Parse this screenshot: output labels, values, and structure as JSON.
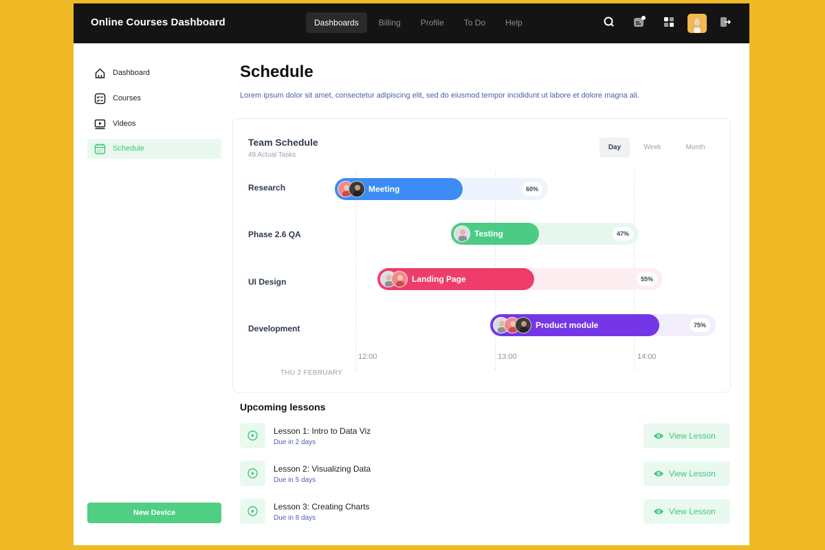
{
  "header": {
    "title": "Online Courses Dashboard",
    "nav": [
      {
        "label": "Dashboards",
        "active": true
      },
      {
        "label": "Billing",
        "active": false
      },
      {
        "label": "Profile",
        "active": false
      },
      {
        "label": "To Do",
        "active": false
      },
      {
        "label": "Help",
        "active": false
      }
    ],
    "icons": [
      "search-icon",
      "notification-icon",
      "apps-grid-icon",
      "avatar",
      "logout-icon"
    ]
  },
  "sidebar": {
    "items": [
      {
        "label": "Dashboard",
        "icon": "home-icon",
        "active": false
      },
      {
        "label": "Courses",
        "icon": "checklist-icon",
        "active": false
      },
      {
        "label": "Videos",
        "icon": "video-icon",
        "active": false
      },
      {
        "label": "Schedule",
        "icon": "calendar-icon",
        "active": true
      }
    ],
    "new_device_label": "New Device"
  },
  "main": {
    "title": "Schedule",
    "subtitle": "Lorem ipsum dolor sit amet, consectetur adipiscing elit, sed do eiusmod  tempor incididunt ut labore et dolore magna ali."
  },
  "schedule": {
    "title": "Team Schedule",
    "subtitle": "49 Actual Tasks",
    "ranges": [
      {
        "label": "Day",
        "active": true
      },
      {
        "label": "Week",
        "active": false
      },
      {
        "label": "Month",
        "active": false
      }
    ],
    "rows": [
      {
        "label": "Research",
        "task": "Meeting",
        "percent": 60,
        "percent_label": "60%",
        "color": "#3b8cf5",
        "track_color": "#eef4fd",
        "avatars": 2
      },
      {
        "label": "Phase 2.6 QA",
        "task": "Testing",
        "percent": 47,
        "percent_label": "47%",
        "color": "#4ccb85",
        "track_color": "#e6f8ee",
        "avatars": 1
      },
      {
        "label": "UI Design",
        "task": "Landing Page",
        "percent": 55,
        "percent_label": "55%",
        "color": "#ee3d6b",
        "track_color": "#fdeef2",
        "avatars": 2
      },
      {
        "label": "Development",
        "task": "Product module",
        "percent": 75,
        "percent_label": "75%",
        "color": "#7436e6",
        "track_color": "#f2eefb",
        "avatars": 3
      }
    ],
    "ticks": [
      "12:00",
      "13:00",
      "14:00"
    ],
    "date_label": "THU 2 FEBRUARY"
  },
  "lessons": {
    "title": "Upcoming lessons",
    "items": [
      {
        "title": "Lesson 1: Intro to Data Viz",
        "due": "Due in 2 days",
        "button": "View Lesson"
      },
      {
        "title": "Lesson 2: Visualizing Data",
        "due": "Due in 5 days",
        "button": "View Lesson"
      },
      {
        "title": "Lesson 3: Creating Charts",
        "due": "Due in 8 days",
        "button": "View Lesson"
      }
    ]
  },
  "colors": {
    "background": "#f0b926",
    "topbar": "#141414",
    "accent_green": "#4fcf84",
    "link_blue": "#4a5fa8"
  }
}
